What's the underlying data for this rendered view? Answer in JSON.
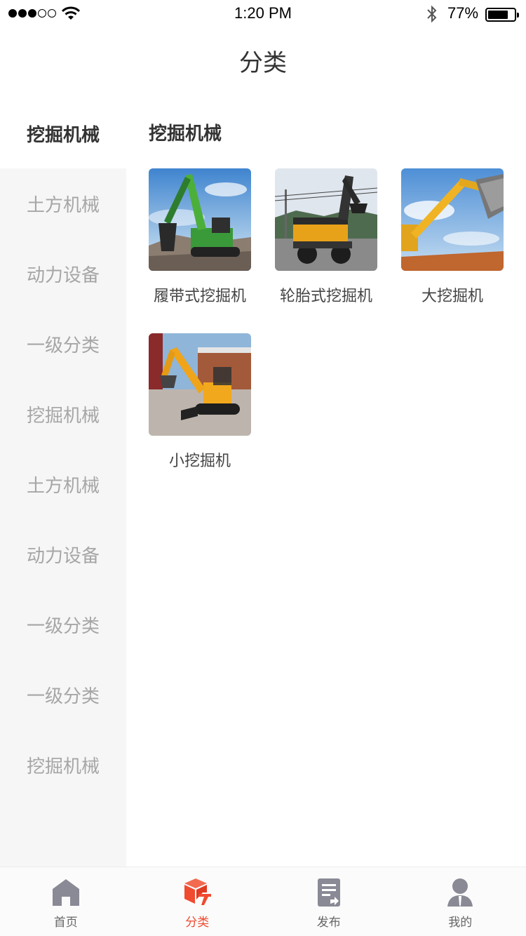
{
  "status_bar": {
    "time": "1:20 PM",
    "battery_percent": "77%",
    "battery_level": 0.77,
    "signal_bars": 3,
    "signal_total": 5
  },
  "nav": {
    "title": "分类"
  },
  "sidebar": {
    "items": [
      {
        "label": "挖掘机械",
        "active": true
      },
      {
        "label": "土方机械"
      },
      {
        "label": "动力设备"
      },
      {
        "label": "一级分类"
      },
      {
        "label": "挖掘机械"
      },
      {
        "label": "土方机械"
      },
      {
        "label": "动力设备"
      },
      {
        "label": "一级分类"
      },
      {
        "label": "一级分类"
      },
      {
        "label": "挖掘机械"
      }
    ]
  },
  "content": {
    "section_title": "挖掘机械",
    "products": [
      {
        "label": "履带式挖掘机",
        "image": "green-crawler-excavator"
      },
      {
        "label": "轮胎式挖掘机",
        "image": "wheeled-excavator"
      },
      {
        "label": "大挖掘机",
        "image": "large-yellow-excavator"
      },
      {
        "label": "小挖掘机",
        "image": "mini-excavator"
      }
    ]
  },
  "tabbar": {
    "tabs": [
      {
        "label": "首页",
        "icon": "home-icon"
      },
      {
        "label": "分类",
        "icon": "category-box-icon",
        "active": true
      },
      {
        "label": "发布",
        "icon": "publish-document-icon"
      },
      {
        "label": "我的",
        "icon": "profile-user-icon"
      }
    ]
  },
  "colors": {
    "accent": "#f04a30",
    "sidebar_bg": "#f6f6f6",
    "inactive_text": "#a6a6a6",
    "tab_icon_inactive": "#8a8a96"
  }
}
